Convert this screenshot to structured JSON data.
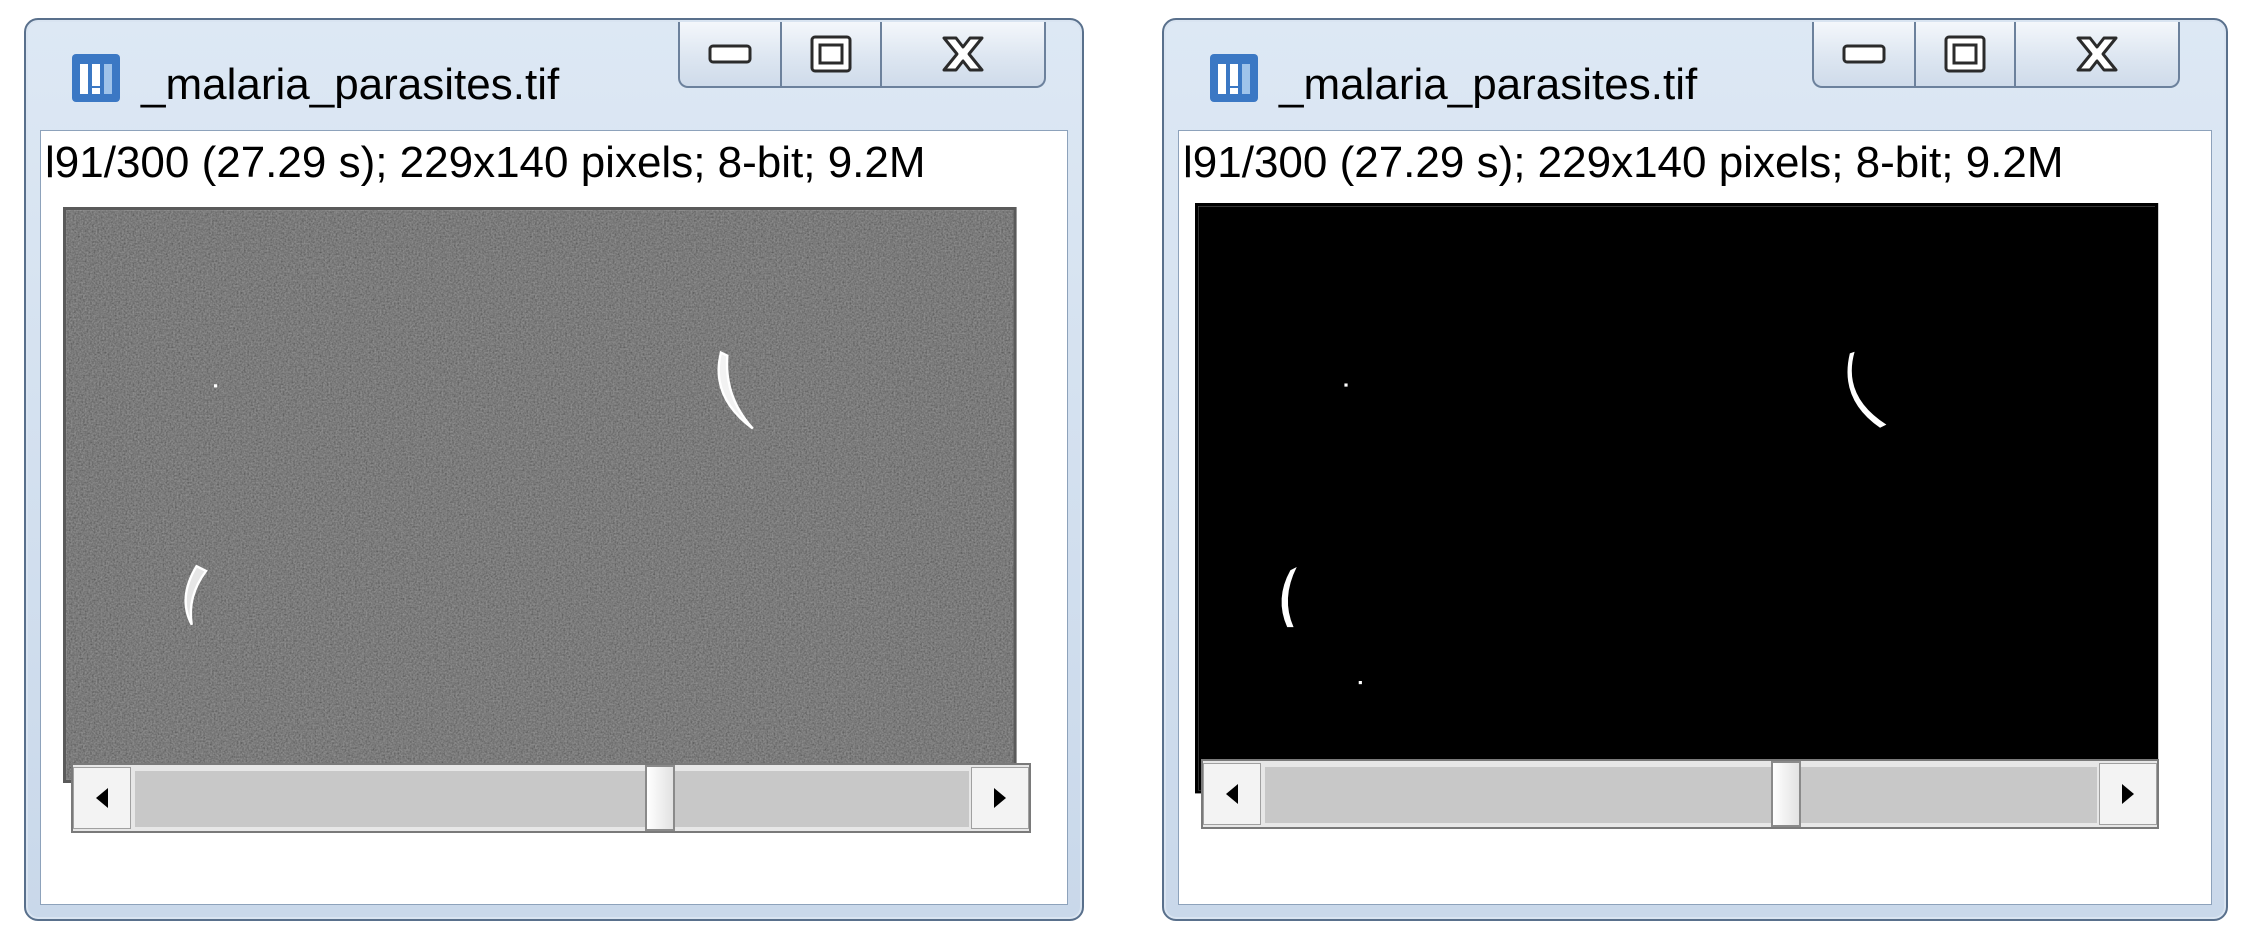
{
  "windows": [
    {
      "id": "original",
      "title": "_malaria_parasites.tif",
      "info": "l91/300 (27.29 s); 229x140 pixels; 8-bit; 9.2M",
      "app_icon": "imagej-icon",
      "buttons": {
        "minimize_icon": "minimize-icon",
        "maximize_icon": "maximize-icon",
        "close_icon": "close-icon"
      },
      "image": {
        "kind": "grayscale-noisy",
        "background_color": "#3a3a3a"
      },
      "scrollbar": {
        "position_fraction": 0.67
      }
    },
    {
      "id": "thresholded",
      "title": "_malaria_parasites.tif",
      "info": "l91/300 (27.29 s); 229x140 pixels; 8-bit; 9.2M",
      "app_icon": "imagej-icon",
      "buttons": {
        "minimize_icon": "minimize-icon",
        "maximize_icon": "maximize-icon",
        "close_icon": "close-icon"
      },
      "image": {
        "kind": "binary-mask",
        "background_color": "#000000"
      },
      "scrollbar": {
        "position_fraction": 0.67
      }
    }
  ],
  "colors": {
    "frame": "#c9d8ea",
    "frame_border": "#59708c",
    "icon_blue": "#3b78c4"
  }
}
